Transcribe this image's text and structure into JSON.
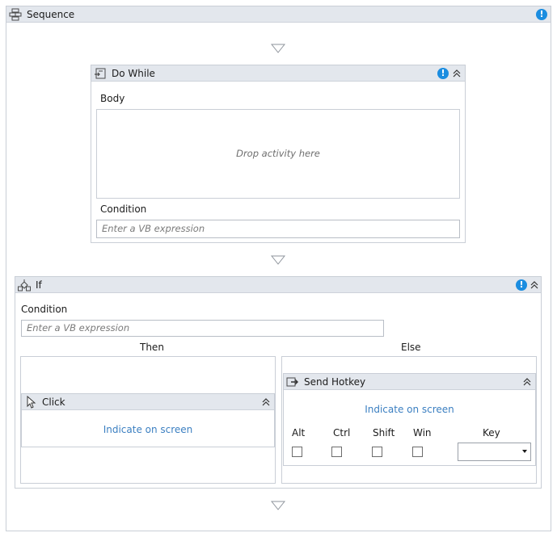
{
  "sequence": {
    "title": "Sequence",
    "warn_glyph": "!",
    "icon": "sequence-icon"
  },
  "do_while": {
    "title": "Do While",
    "warn_glyph": "!",
    "icon": "do-while-icon",
    "body_label": "Body",
    "drop_placeholder": "Drop activity here",
    "condition_label": "Condition",
    "condition_placeholder": "Enter a VB expression"
  },
  "if_activity": {
    "title": "If",
    "warn_glyph": "!",
    "icon": "if-icon",
    "condition_label": "Condition",
    "condition_placeholder": "Enter a VB expression",
    "then_label": "Then",
    "else_label": "Else"
  },
  "click_activity": {
    "title": "Click",
    "icon": "cursor-icon",
    "indicate_label": "Indicate on screen"
  },
  "send_hotkey": {
    "title": "Send Hotkey",
    "icon": "send-hotkey-icon",
    "indicate_label": "Indicate on screen",
    "modifiers": [
      "Alt",
      "Ctrl",
      "Shift",
      "Win"
    ],
    "key_label": "Key",
    "key_value": ""
  },
  "colors": {
    "header_bg": "#e3e7ed",
    "border": "#c9ced6",
    "link": "#3b7fc1",
    "warning": "#1b8de0"
  }
}
